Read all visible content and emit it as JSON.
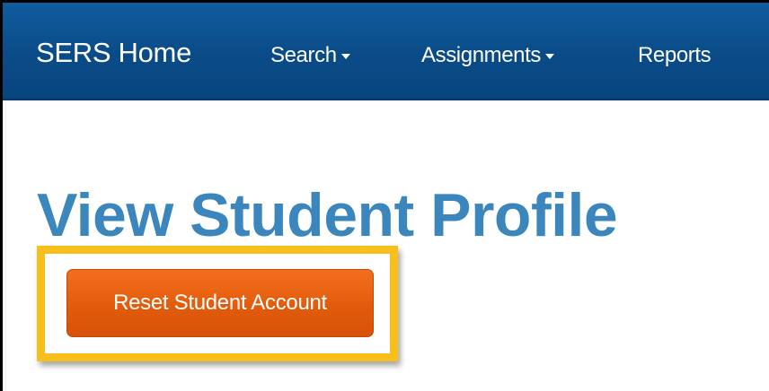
{
  "navbar": {
    "brand": "SERS Home",
    "items": [
      {
        "label": "Search",
        "dropdown": true
      },
      {
        "label": "Assignments",
        "dropdown": true
      },
      {
        "label": "Reports",
        "dropdown": false
      }
    ],
    "background_color": "#0a4b87",
    "text_color": "#ffffff"
  },
  "main": {
    "title": "View Student Profile",
    "title_color": "#3a86bd",
    "reset_button_label": "Reset Student Account",
    "reset_button_color": "#e15a0b",
    "highlight_color": "#f8bf1a"
  },
  "icons": {
    "dropdown_caret": "chevron-down-icon"
  }
}
